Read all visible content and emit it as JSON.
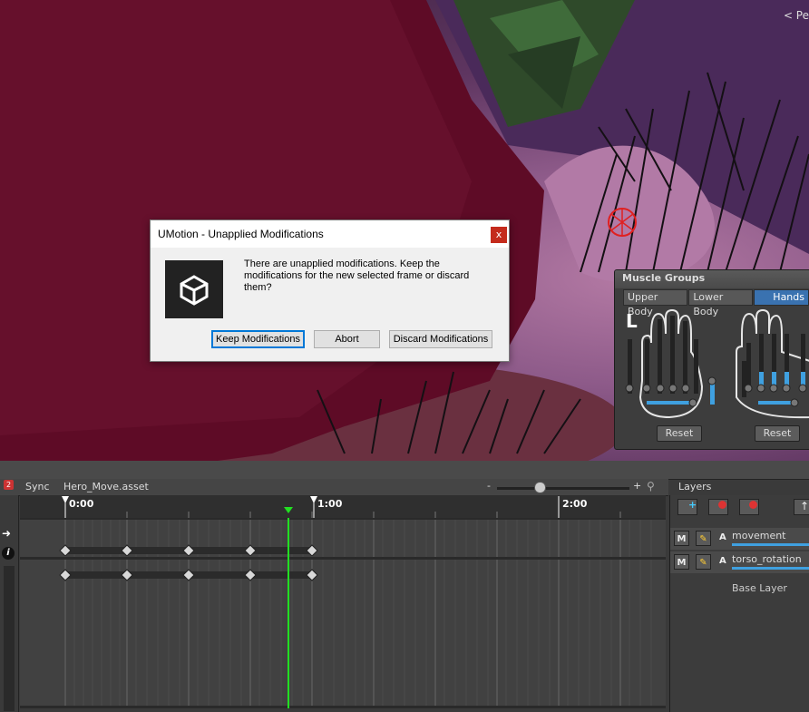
{
  "scene": {
    "top_label": "< Pe"
  },
  "dialog": {
    "title": "UMotion - Unapplied Modifications",
    "close_label": "x",
    "message": "There are unapplied modifications. Keep the modifications for the new selected frame or discard them?",
    "buttons": {
      "keep": "Keep Modifications",
      "abort": "Abort",
      "discard": "Discard Modifications"
    }
  },
  "muscle_groups": {
    "title": "Muscle Groups",
    "tabs": [
      "Upper Body",
      "Lower Body",
      "Hands"
    ],
    "active_tab": "Hands",
    "hand_label": "L",
    "reset_left": "Reset",
    "reset_right": "Reset"
  },
  "timeline": {
    "badge": "2",
    "sync_label": "Sync",
    "asset_name": "Hero_Move.asset",
    "zoom_minus": "-",
    "zoom_plus": "+",
    "ruler_labels": [
      "0:00",
      "1:00",
      "2:00"
    ]
  },
  "layers": {
    "title": "Layers",
    "items": [
      {
        "m": "M",
        "a": "A",
        "name": "movement"
      },
      {
        "m": "M",
        "a": "A",
        "name": "torso_rotation"
      }
    ],
    "base_layer": "Base Layer"
  },
  "colors": {
    "accent_blue": "#3a72b0",
    "playhead_green": "#22e022",
    "dialog_primary": "#0078d7",
    "close_red": "#c42b1c"
  }
}
